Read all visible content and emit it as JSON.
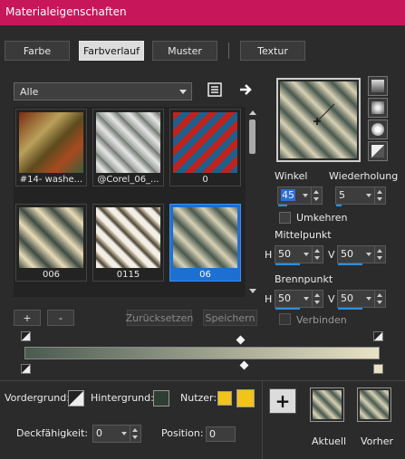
{
  "window": {
    "title": "Materialeigenschaften"
  },
  "tabs": [
    {
      "label": "Farbe",
      "selected": false
    },
    {
      "label": "Farbverlauf",
      "selected": true
    },
    {
      "label": "Muster",
      "selected": false
    },
    {
      "label": "Textur",
      "selected": false
    }
  ],
  "category": {
    "value": "Alle"
  },
  "icons": {
    "menu": "menu-list-icon",
    "arrow": "arrow-right-icon"
  },
  "gallery": {
    "items": [
      {
        "caption": "#14- washe...",
        "selected": false
      },
      {
        "caption": "@Corel_06_...",
        "selected": false
      },
      {
        "caption": "0",
        "selected": false
      },
      {
        "caption": "006",
        "selected": false
      },
      {
        "caption": "0115",
        "selected": false
      },
      {
        "caption": "06",
        "selected": true
      }
    ]
  },
  "angle": {
    "label": "Winkel",
    "value": "45"
  },
  "repeat": {
    "label": "Wiederholung",
    "value": "5"
  },
  "invert": {
    "label": "Umkehren",
    "checked": false
  },
  "center": {
    "label": "Mittelpunkt",
    "h_label": "H",
    "h": "50",
    "v_label": "V",
    "v": "50"
  },
  "focus": {
    "label": "Brennpunkt",
    "h_label": "H",
    "h": "50",
    "v_label": "V",
    "v": "50"
  },
  "link": {
    "label": "Verbinden",
    "checked": false,
    "disabled": true
  },
  "actions": {
    "add": "+",
    "remove": "-",
    "reset": "Zurücksetzen",
    "save": "Speichern"
  },
  "bottom": {
    "foreground_label": "Vordergrund:",
    "background_label": "Hintergrund:",
    "user_label": "Nutzer:",
    "opacity_label": "Deckfähigkeit:",
    "opacity_value": "0",
    "position_label": "Position:",
    "position_value": "0",
    "plus_label": "+",
    "current_label": "Aktuell",
    "previous_label": "Vorher"
  },
  "colors": {
    "accent": "#c8165a",
    "selected": "#1e6fd2",
    "user": "#f2c318",
    "gradient_start": "#4a5b50",
    "gradient_end": "#e9e2c6"
  }
}
